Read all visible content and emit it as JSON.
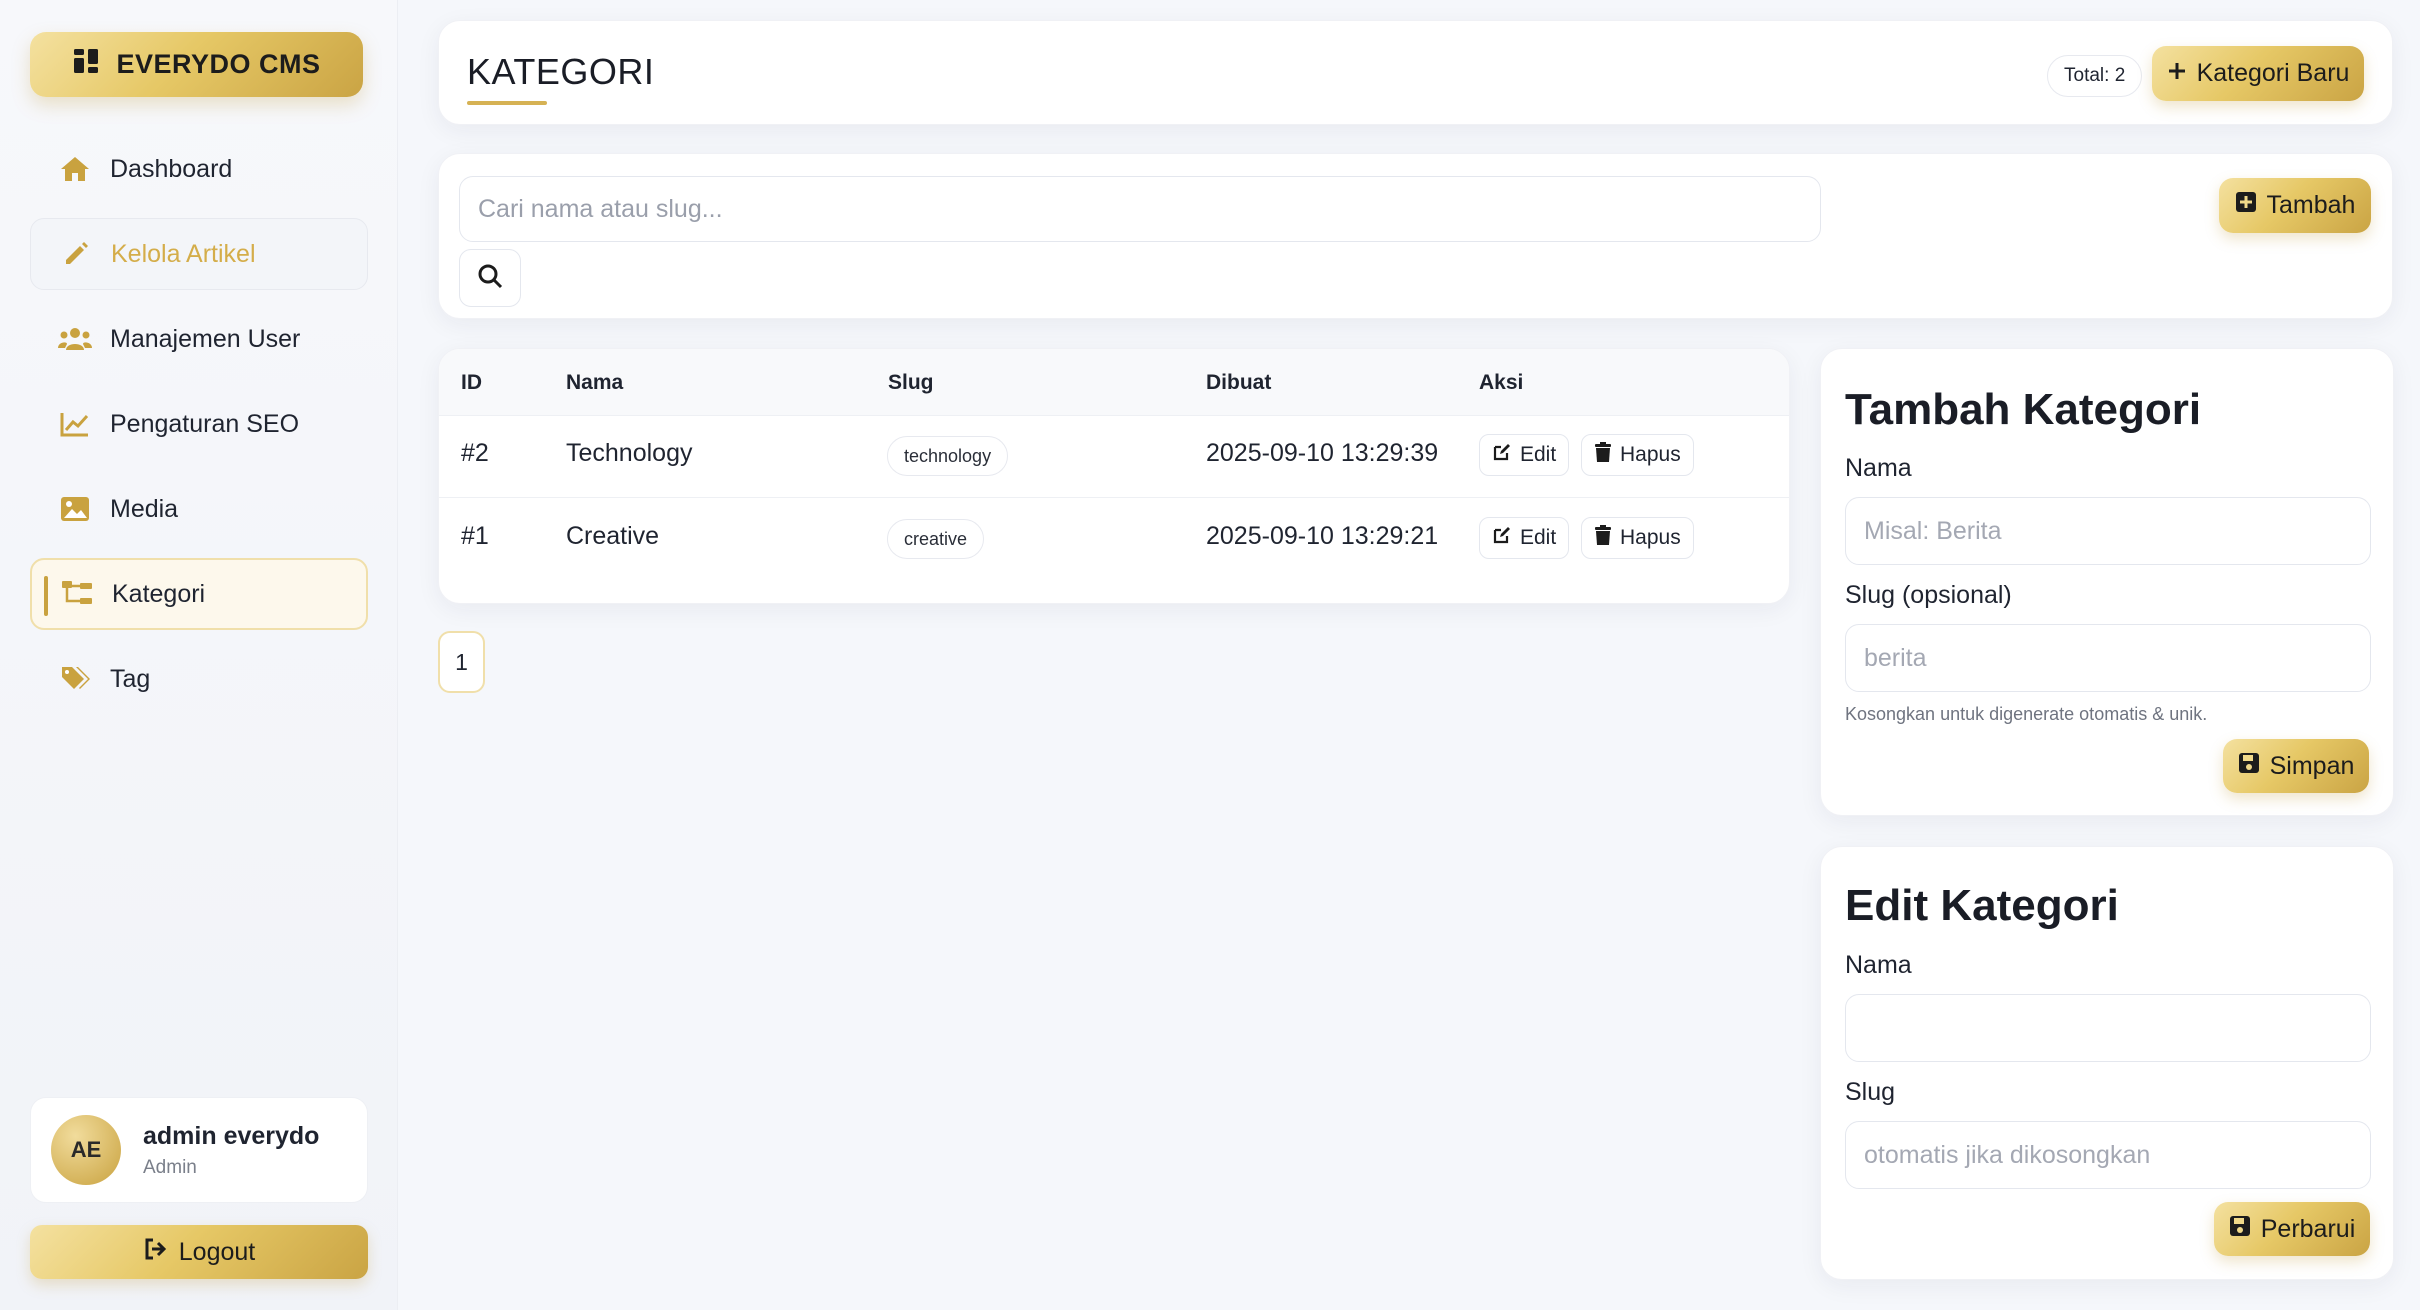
{
  "app": {
    "brand": "EVERYDO CMS"
  },
  "sidebar": {
    "items": [
      {
        "label": "Dashboard",
        "icon": "home-icon"
      },
      {
        "label": "Kelola Artikel",
        "icon": "pencil-icon"
      },
      {
        "label": "Manajemen User",
        "icon": "users-icon"
      },
      {
        "label": "Pengaturan SEO",
        "icon": "chart-line-icon"
      },
      {
        "label": "Media",
        "icon": "image-icon"
      },
      {
        "label": "Kategori",
        "icon": "sitemap-icon"
      },
      {
        "label": "Tag",
        "icon": "tags-icon"
      }
    ],
    "user": {
      "initials": "AE",
      "name": "admin everydo",
      "role": "Admin"
    },
    "logout_label": "Logout"
  },
  "header": {
    "title": "KATEGORI",
    "total": "Total: 2",
    "new_label": "Kategori Baru"
  },
  "search": {
    "placeholder": "Cari nama atau slug...",
    "add_label": "Tambah"
  },
  "table": {
    "headers": {
      "id": "ID",
      "name": "Nama",
      "slug": "Slug",
      "created": "Dibuat",
      "action": "Aksi"
    },
    "rows": [
      {
        "id": "#2",
        "name": "Technology",
        "slug": "technology",
        "created": "2025-09-10 13:29:39"
      },
      {
        "id": "#1",
        "name": "Creative",
        "slug": "creative",
        "created": "2025-09-10 13:29:21"
      }
    ],
    "edit_label": "Edit",
    "delete_label": "Hapus"
  },
  "pagination": {
    "current": "1"
  },
  "add_form": {
    "title": "Tambah Kategori",
    "name_label": "Nama",
    "name_placeholder": "Misal: Berita",
    "slug_label": "Slug (opsional)",
    "slug_placeholder": "berita",
    "hint": "Kosongkan untuk digenerate otomatis & unik.",
    "submit_label": "Simpan"
  },
  "edit_form": {
    "title": "Edit Kategori",
    "name_label": "Nama",
    "name_value": "",
    "slug_label": "Slug",
    "slug_placeholder": "otomatis jika dikosongkan",
    "submit_label": "Perbarui"
  },
  "colors": {
    "accent": "#d6b254",
    "gold_dark": "#caa444",
    "gold_light": "#f4e1a0"
  }
}
